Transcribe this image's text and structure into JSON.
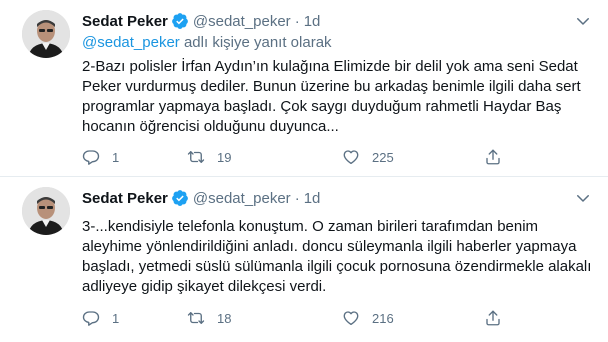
{
  "colors": {
    "accent": "#1da1f2",
    "link": "#1b95e0",
    "secondary_text": "#5b7083",
    "divider": "#e6ecf0"
  },
  "icons": [
    "verified-badge-icon",
    "chevron-down-icon",
    "reply-icon",
    "retweet-icon",
    "like-icon",
    "share-icon"
  ],
  "tweets": [
    {
      "display_name": "Sedat Peker",
      "handle": "@sedat_peker",
      "separator": "·",
      "time": "1d",
      "reply_to_link": "@sedat_peker",
      "reply_to_suffix": " adlı kişiye yanıt olarak",
      "lines": [
        "2-Bazı polisler İrfan Aydın’ın kulağına Elimizde bir delil yok ama seni Sedat",
        "Peker vurdurmuş dediler. Bunun üzerine bu arkadaş benimle ilgili daha sert",
        "programlar yapmaya başladı. Çok saygı duyduğum rahmetli Haydar Baş",
        "hocanın öğrencisi olduğunu duyunca..."
      ],
      "replies": "1",
      "retweets": "19",
      "likes": "225"
    },
    {
      "display_name": "Sedat Peker",
      "handle": "@sedat_peker",
      "separator": "·",
      "time": "1d",
      "lines": [
        "3-...kendisiyle telefonla konuştum. O zaman birileri tarafımdan benim",
        "aleyhime yönlendirildiğini anladı. doncu süleymanla ilgili haberler yapmaya",
        "başladı, yetmedi süslü sülümanla ilgili çocuk pornosuna özendirmekle alakalı",
        "adliyeye gidip şikayet dilekçesi verdi."
      ],
      "replies": "1",
      "retweets": "18",
      "likes": "216"
    }
  ]
}
